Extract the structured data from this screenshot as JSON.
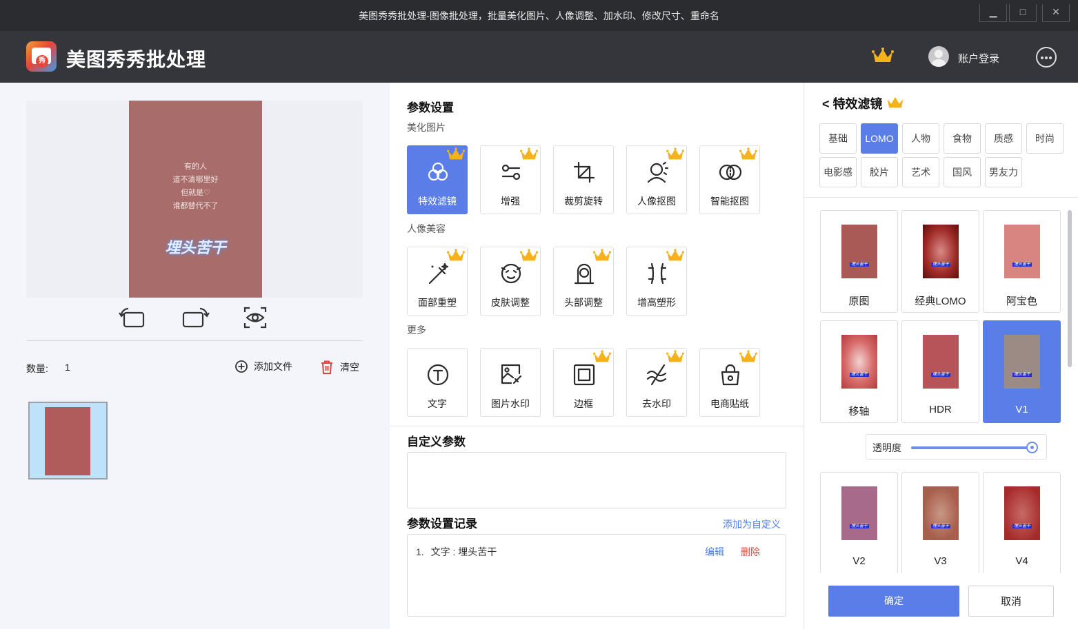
{
  "window": {
    "title": "美图秀秀批处理-图像批处理，批量美化图片、人像调整、加水印、修改尺寸、重命名",
    "minimize": "▁",
    "maximize": "□",
    "close": "✕"
  },
  "header": {
    "app_name": "美图秀秀批处理",
    "login_label": "账户登录"
  },
  "left": {
    "poster_lines": [
      "有的人",
      "道不清哪里好",
      "但就是♡",
      "谁都替代不了"
    ],
    "poster_big_text": "埋头苦干",
    "count_label": "数量:",
    "count_value": "1",
    "add_file_label": "添加文件",
    "clear_label": "清空"
  },
  "middle": {
    "title": "参数设置",
    "groups": [
      {
        "label": "美化图片",
        "items": [
          {
            "label": "特效滤镜",
            "icon": "filter-icon",
            "crown": true,
            "active": true
          },
          {
            "label": "增强",
            "icon": "enhance-icon",
            "crown": true,
            "active": false
          },
          {
            "label": "裁剪旋转",
            "icon": "crop-icon",
            "crown": false,
            "active": false
          },
          {
            "label": "人像抠图",
            "icon": "portrait-cutout-icon",
            "crown": true,
            "active": false
          },
          {
            "label": "智能抠图",
            "icon": "smart-cutout-icon",
            "crown": true,
            "active": false
          }
        ]
      },
      {
        "label": "人像美容",
        "items": [
          {
            "label": "面部重塑",
            "icon": "face-reshape-icon",
            "crown": true,
            "active": false
          },
          {
            "label": "皮肤调整",
            "icon": "skin-adjust-icon",
            "crown": true,
            "active": false
          },
          {
            "label": "头部调整",
            "icon": "head-adjust-icon",
            "crown": true,
            "active": false
          },
          {
            "label": "增高塑形",
            "icon": "body-shape-icon",
            "crown": true,
            "active": false
          }
        ]
      },
      {
        "label": "更多",
        "items": [
          {
            "label": "文字",
            "icon": "text-icon",
            "crown": false,
            "active": false
          },
          {
            "label": "图片水印",
            "icon": "image-watermark-icon",
            "crown": false,
            "active": false
          },
          {
            "label": "边框",
            "icon": "border-icon",
            "crown": true,
            "active": false
          },
          {
            "label": "去水印",
            "icon": "remove-watermark-icon",
            "crown": true,
            "active": false
          },
          {
            "label": "电商贴纸",
            "icon": "sticker-icon",
            "crown": true,
            "active": false
          }
        ]
      }
    ],
    "custom_title": "自定义参数",
    "record_title": "参数设置记录",
    "add_custom_label": "添加为自定义",
    "records": [
      {
        "index": "1.",
        "text": "文字 : 埋头苦干",
        "edit": "编辑",
        "delete": "删除"
      }
    ]
  },
  "right": {
    "back_title": "< 特效滤镜",
    "categories": [
      {
        "label": "基础",
        "active": false
      },
      {
        "label": "LOMO",
        "active": true
      },
      {
        "label": "人物",
        "active": false
      },
      {
        "label": "食物",
        "active": false
      },
      {
        "label": "质感",
        "active": false
      },
      {
        "label": "时尚",
        "active": false
      },
      {
        "label": "电影感",
        "active": false
      },
      {
        "label": "胶片",
        "active": false
      },
      {
        "label": "艺术",
        "active": false
      },
      {
        "label": "国风",
        "active": false
      },
      {
        "label": "男友力",
        "active": false
      }
    ],
    "filters": [
      {
        "label": "原图",
        "style": "orig",
        "active": false
      },
      {
        "label": "经典LOMO",
        "style": "lomo",
        "active": false
      },
      {
        "label": "阿宝色",
        "style": "abao",
        "active": false
      },
      {
        "label": "移轴",
        "style": "tilt",
        "active": false
      },
      {
        "label": "HDR",
        "style": "hdr",
        "active": false
      },
      {
        "label": "V1",
        "style": "v1",
        "active": true
      },
      {
        "label": "V2",
        "style": "v2",
        "active": false
      },
      {
        "label": "V3",
        "style": "v3",
        "active": false
      },
      {
        "label": "V4",
        "style": "v4",
        "active": false
      }
    ],
    "thumb_text": "埋头苦干",
    "opacity_label": "透明度",
    "opacity_value": 0.98,
    "ok_label": "确定",
    "cancel_label": "取消"
  },
  "colors": {
    "accent": "#5a7de8",
    "crown": "#f5b21a",
    "danger": "#e2443c"
  }
}
